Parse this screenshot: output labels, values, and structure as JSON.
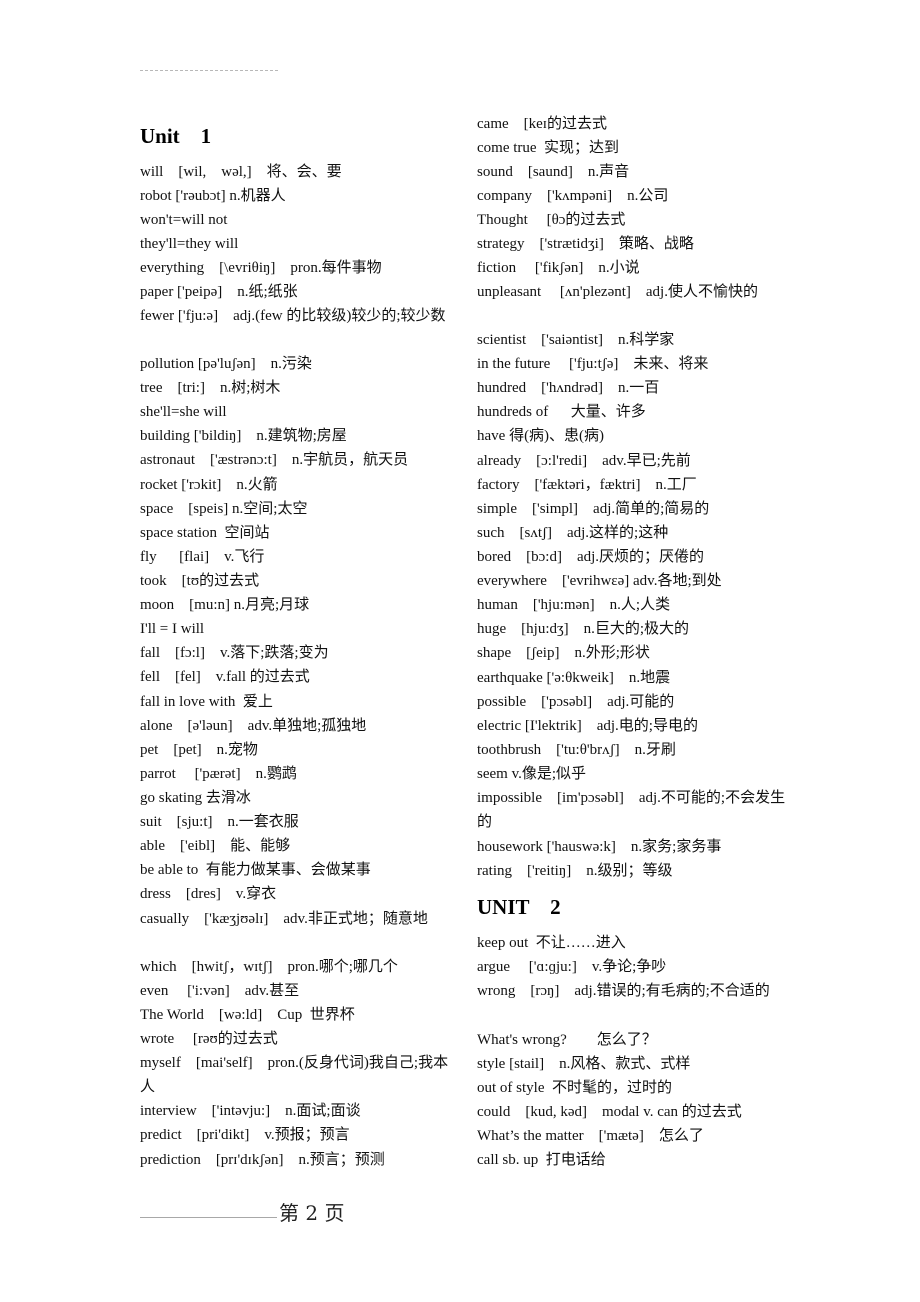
{
  "document": {
    "left_column": {
      "unit_title": "Unit    1",
      "entries": [
        "will    [wil,    wəl,]    将、会、要",
        "robot ['rəubɔt] n.机器人",
        "won't=will not",
        "they'll=they will",
        "everything    [\\evriθiŋ]    pron.每件事物",
        "paper ['peipə]    n.纸;纸张",
        "fewer ['fju:ə]    adj.(few 的比较级)较少的;较少数",
        "pollution [pə'luʃən]    n.污染",
        "tree    [tri:]    n.树;树木",
        "she'll=she will",
        "building ['bildiŋ]    n.建筑物;房屋",
        "astronaut    ['æstrənɔ:t]    n.宇航员，航天员",
        "rocket ['rɔkit]    n.火箭",
        "space    [speis] n.空间;太空",
        "space station  空间站",
        "fly      [flai]    v.飞行",
        "took    [tʊ的过去式",
        "moon    [mu:n] n.月亮;月球",
        "I'll = I will",
        "fall    [fɔ:l]    v.落下;跌落;变为",
        "fell    [fel]    v.fall 的过去式",
        "fall in love with  爱上",
        "alone    [ə'ləun]    adv.单独地;孤独地",
        "pet    [pet]    n.宠物",
        "parrot     ['pærət]    n.鹦鹉",
        "go skating 去滑冰",
        "suit    [sju:t]    n.一套衣服",
        "able    ['eibl]    能、能够",
        "be able to  有能力做某事、会做某事",
        "dress    [dres]    v.穿衣",
        "casually    ['kæʒjʊəlɪ]    adv.非正式地；随意地",
        "which    [hwitʃ，wɪtʃ]    pron.哪个;哪几个",
        "even     ['i:vən]    adv.甚至",
        "The World    [wə:ld]    Cup  世界杯",
        "wrote     [rəʊ的过去式",
        "myself    [mai'self]    pron.(反身代词)我自己;我本人",
        "interview    ['intəvju:]    n.面试;面谈",
        "predict    [pri'dikt]    v.预报；预言",
        "prediction    [prɪ'dɪkʃən]    n.预言；预测"
      ]
    },
    "right_column": {
      "entries_before_unit": [
        "came    [keɪ的过去式",
        "come true  实现；达到",
        "sound    [saund]    n.声音",
        "company    ['kʌmpəni]    n.公司",
        "Thought     [θɔ的过去式",
        "strategy    ['strætidʒi]    策略、战略",
        "fiction     ['fikʃən]    n.小说",
        "unpleasant     [ʌn'plezənt]    adj.使人不愉快的",
        "scientist    ['saiəntist]    n.科学家",
        "in the future     ['fju:tʃə]    未来、将来",
        "hundred    ['hʌndrəd]    n.一百",
        "hundreds of      大量、许多",
        "have 得(病)、患(病)",
        "already    [ɔ:l'redi]    adv.早已;先前",
        "factory    ['fæktəri，fæktri]    n.工厂",
        "simple    ['simpl]    adj.简单的;简易的",
        "such    [sʌtʃ]    adj.这样的;这种",
        "bored    [bɔ:d]    adj.厌烦的；厌倦的",
        "everywhere    ['evrihwɛə] adv.各地;到处",
        "human    ['hju:mən]    n.人;人类",
        "huge    [hju:dʒ]    n.巨大的;极大的",
        "shape    [ʃeip]    n.外形;形状",
        "earthquake ['ə:θkweik]    n.地震",
        "possible    ['pɔsəbl]    adj.可能的",
        "electric [I'lektrik]    adj.电的;导电的",
        "toothbrush    ['tu:θ'brʌʃ]    n.牙刷",
        "seem v.像是;似乎",
        "impossible    [im'pɔsəbl]    adj.不可能的;不会发生的",
        "housework ['hauswə:k]    n.家务;家务事",
        "rating    ['reitiŋ]    n.级别；等级"
      ],
      "unit_title": "UNIT    2",
      "entries_after_unit": [
        "keep out  不让……进入",
        "argue     ['ɑ:ɡju:]    v.争论;争吵",
        "wrong    [rɔŋ]    adj.错误的;有毛病的;不合适的",
        "What's wrong?        怎么了？",
        "style [stail]    n.风格、款式、式样",
        "out of style  不时髦的，过时的",
        "could    [kud, kəd]    modal v. can 的过去式",
        "What’s the matter    ['mætə]    怎么了",
        "call sb. up  打电话给"
      ]
    },
    "footer": {
      "page_label": "第 2 页"
    }
  }
}
